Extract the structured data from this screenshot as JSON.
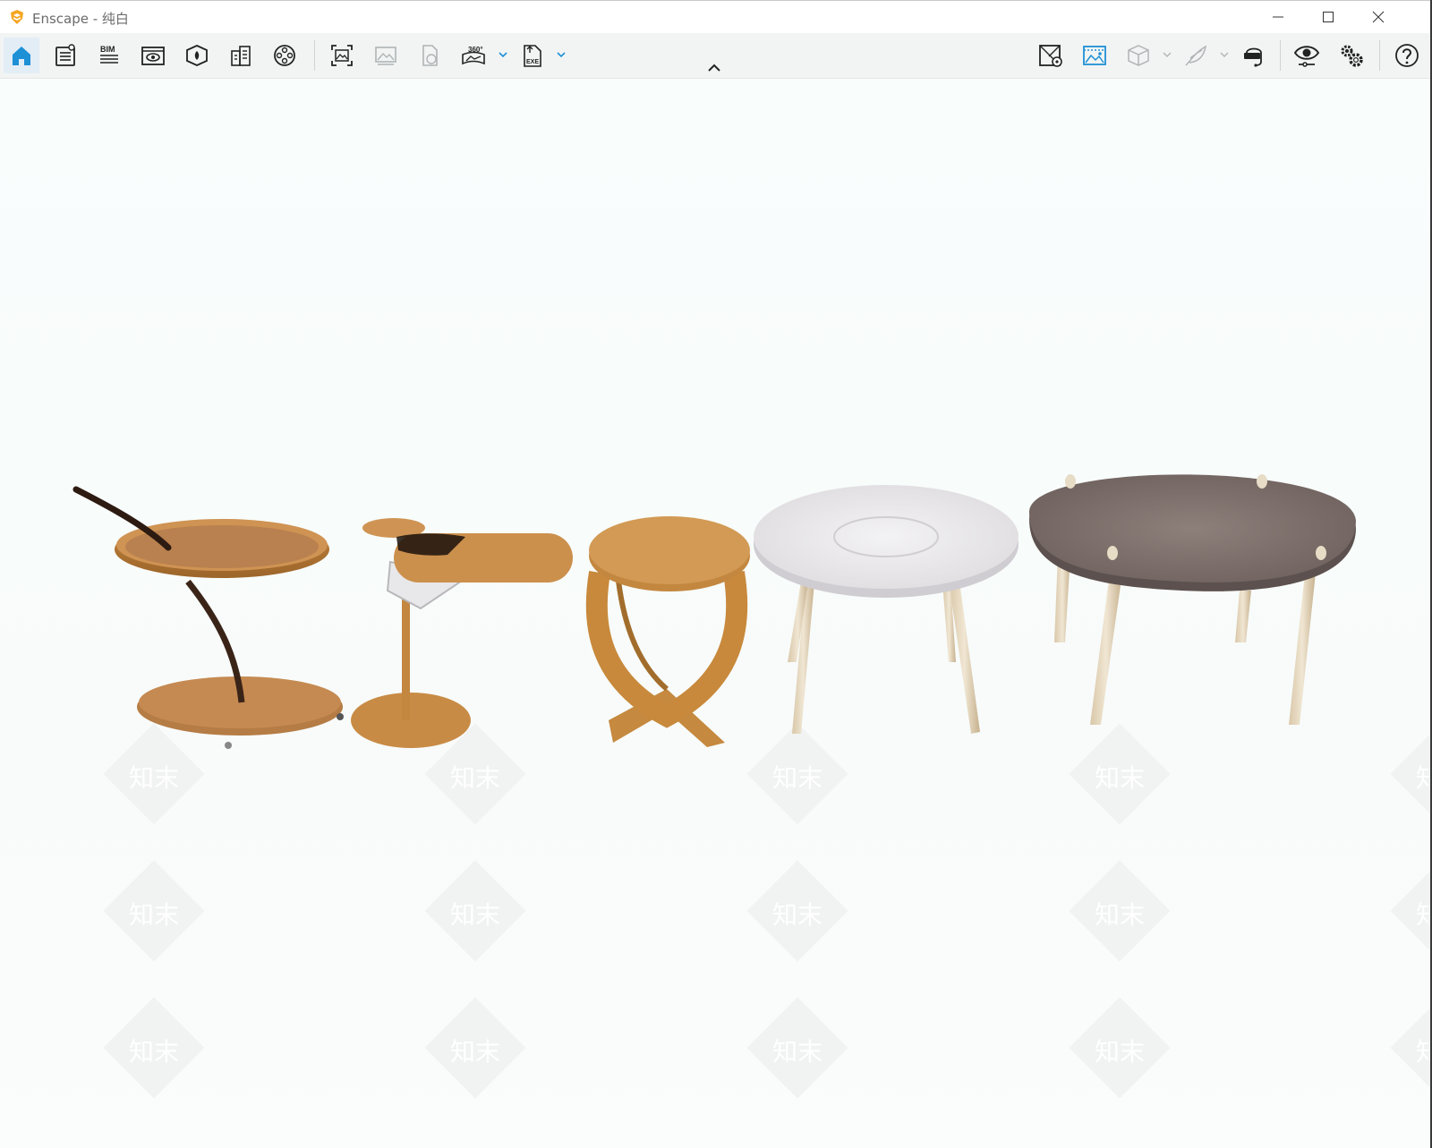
{
  "window": {
    "title": "Enscape - 纯白",
    "controls": [
      "minimize-icon",
      "maximize-icon",
      "close-icon"
    ]
  },
  "toolbar": {
    "left_icons": [
      {
        "name": "home-icon",
        "active": true
      },
      {
        "name": "settings-list-icon"
      },
      {
        "name": "bim-icon",
        "label": "BIM"
      },
      {
        "name": "view-window-icon"
      },
      {
        "name": "asset-library-icon"
      },
      {
        "name": "building-icon"
      },
      {
        "name": "video-reel-icon"
      },
      {
        "name": "screenshot-icon"
      },
      {
        "name": "gallery-icon"
      },
      {
        "name": "web-standalone-icon"
      },
      {
        "name": "panorama-360-icon",
        "label": "360°"
      },
      {
        "name": "export-exe-icon",
        "label": "EXE"
      }
    ],
    "right_icons": [
      {
        "name": "map-icon"
      },
      {
        "name": "render-view-icon"
      },
      {
        "name": "cube-icon"
      },
      {
        "name": "feather-icon"
      },
      {
        "name": "vr-headset-icon"
      },
      {
        "name": "visual-settings-eye-icon"
      },
      {
        "name": "gear-settings-icon"
      },
      {
        "name": "help-icon"
      }
    ],
    "accent_color": "#1e90d6"
  },
  "viewport": {
    "watermark_text": "知末",
    "scene": [
      "side-table-tray-cart",
      "side-table-cantilever",
      "side-table-wood-x-base",
      "round-table-white-marble",
      "round-table-grey-stone"
    ]
  }
}
